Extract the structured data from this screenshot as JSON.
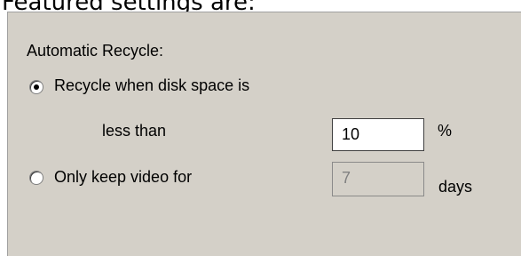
{
  "header_text": "Featured settings are:",
  "section_label": "Automatic Recycle:",
  "options": [
    {
      "label": "Recycle when disk space is",
      "selected": true
    },
    {
      "label": "Only keep video for",
      "selected": false
    }
  ],
  "less_than_label": "less than",
  "percent_input": {
    "value": "10",
    "unit": "%",
    "enabled": true
  },
  "days_input": {
    "value": "7",
    "unit": "days",
    "enabled": false
  }
}
